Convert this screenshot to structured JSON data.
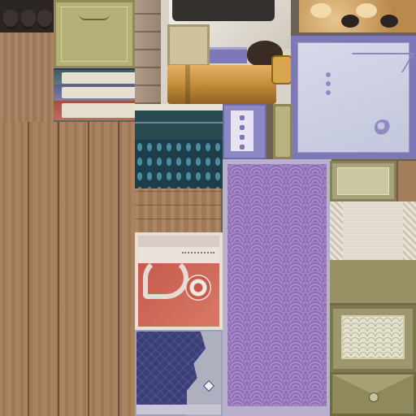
{
  "atlas": {
    "canvas_size": "512x512",
    "content": "texture-atlas",
    "tiles": [
      {
        "id": "top-dark-cups",
        "material": "dark-ceramic"
      },
      {
        "id": "olive-cover",
        "material": "olive-cloth"
      },
      {
        "id": "book-spine-teal",
        "material": "teal-binding"
      },
      {
        "id": "book-spine-blue",
        "material": "blue-binding"
      },
      {
        "id": "book-spine-red",
        "material": "red-binding"
      },
      {
        "id": "stone-column",
        "material": "stone"
      },
      {
        "id": "gold-tube",
        "material": "brass"
      },
      {
        "id": "lavender-frame",
        "material": "lavender-paper"
      },
      {
        "id": "teal-textile",
        "material": "teal-pattern"
      },
      {
        "id": "purple-seigaiha",
        "material": "wave-pattern"
      },
      {
        "id": "red-swirl-card",
        "material": "red-paper"
      },
      {
        "id": "navy-zigzag",
        "material": "navy-cloth"
      },
      {
        "id": "wood-planks",
        "material": "wood"
      },
      {
        "id": "olive-lattice-box",
        "material": "olive-cloth"
      },
      {
        "id": "olive-envelope",
        "material": "olive-cloth"
      }
    ]
  },
  "colors": {
    "wood": "#a67e5a",
    "lavender": "#7c79b6",
    "purple": "#8d6cb4",
    "teal": "#1f3e4c",
    "red": "#c55b4c",
    "navy": "#3b3f78",
    "olive": "#9c976d",
    "gold": "#c9913f"
  }
}
